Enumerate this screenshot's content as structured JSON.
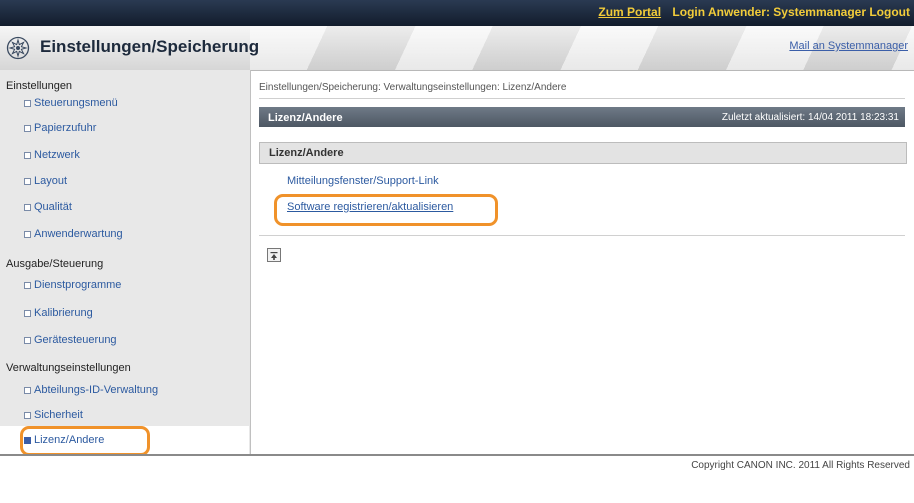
{
  "topbar": {
    "portal_link": "Zum Portal",
    "login_label": "Login Anwender: Systemmanager",
    "logout_link": "Logout"
  },
  "header": {
    "title": "Einstellungen/Speicherung",
    "mail_link": "Mail an Systemmanager"
  },
  "sidebar": {
    "categories": [
      {
        "label": "Einstellungen",
        "items": [
          "Steuerungsmenü",
          "Papierzufuhr",
          "Netzwerk",
          "Layout",
          "Qualität",
          "Anwenderwartung"
        ]
      },
      {
        "label": "Ausgabe/Steuerung",
        "items": [
          "Dienstprogramme",
          "Kalibrierung",
          "Gerätesteuerung"
        ]
      },
      {
        "label": "Verwaltungseinstellungen",
        "items": [
          "Abteilungs-ID-Verwaltung",
          "Sicherheit",
          "Lizenz/Andere"
        ]
      }
    ],
    "active_item": "Lizenz/Andere"
  },
  "main": {
    "breadcrumb": "Einstellungen/Speicherung: Verwaltungseinstellungen: Lizenz/Andere",
    "section_title": "Lizenz/Andere",
    "last_updated": "Zuletzt aktualisiert: 14/04 2011 18:23:31",
    "subsection_title": "Lizenz/Andere",
    "links": [
      "Mitteilungsfenster/Support-Link",
      "Software registrieren/aktualisieren"
    ]
  },
  "footer": {
    "copyright": "Copyright CANON INC. 2011 All Rights Reserved"
  },
  "colors": {
    "accent_highlight": "#f0922a",
    "link": "#2c5aa0",
    "topbar_text": "#f2cc3a"
  }
}
